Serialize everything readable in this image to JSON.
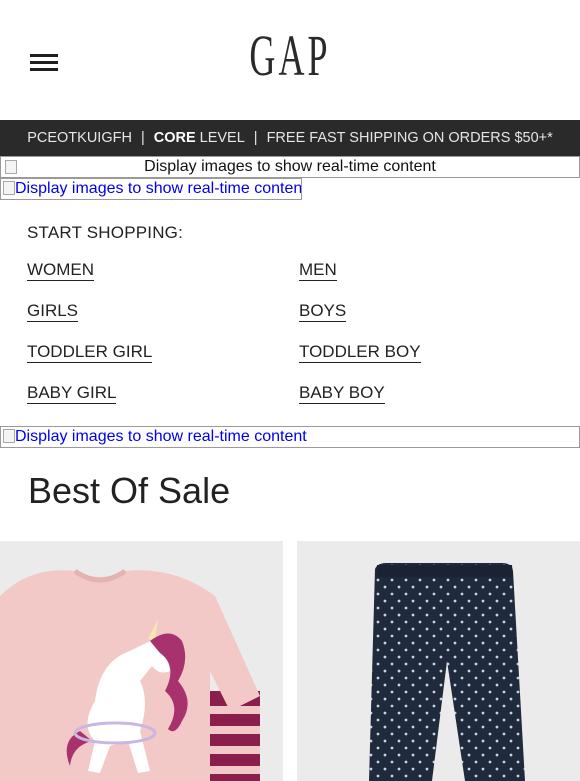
{
  "brand": {
    "logo_text": "GAP"
  },
  "banner": {
    "code": "PCEOTKUIGFH",
    "separator": "|",
    "level_strong": "CORE",
    "level_rest": "LEVEL",
    "shipping": "FREE FAST SHIPPING ON ORDERS $50+*"
  },
  "placeholders": {
    "alt_text_1": "Display images to show real-time content",
    "alt_text_2": "Display images to show real-time content",
    "alt_text_3": "Display images to show real-time content"
  },
  "shop": {
    "title": "START SHOPPING:",
    "links": [
      "WOMEN",
      "MEN",
      "GIRLS",
      "BOYS",
      "TODDLER GIRL",
      "TODDLER BOY",
      "BABY GIRL",
      "BABY BOY"
    ]
  },
  "section": {
    "title": "Best Of Sale"
  },
  "colors": {
    "banner_bg": "#2a2a2a",
    "link_blue": "#0000ee",
    "pajama_pink": "#f2c9c6",
    "stripe_burgundy": "#8a1f4e",
    "legging_navy": "#1f2a3d"
  },
  "icons": {
    "menu": "hamburger-menu-icon",
    "broken_image": "broken-image-icon"
  }
}
